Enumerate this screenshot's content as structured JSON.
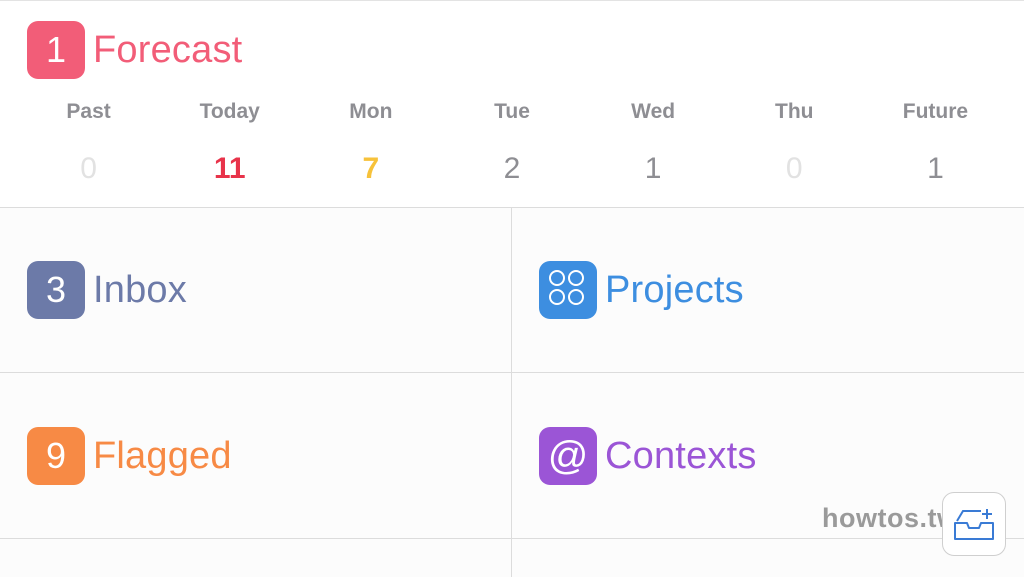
{
  "forecast": {
    "badge": "1",
    "title": "Forecast",
    "color": "#f25d78",
    "days": [
      {
        "label": "Past",
        "count": "0",
        "color": "#e2e2e2"
      },
      {
        "label": "Today",
        "count": "11",
        "color": "#e8334a"
      },
      {
        "label": "Mon",
        "count": "7",
        "color": "#f7c23a"
      },
      {
        "label": "Tue",
        "count": "2",
        "color": "#8e8e93"
      },
      {
        "label": "Wed",
        "count": "1",
        "color": "#8e8e93"
      },
      {
        "label": "Thu",
        "count": "0",
        "color": "#e2e2e2"
      },
      {
        "label": "Future",
        "count": "1",
        "color": "#8e8e93"
      }
    ]
  },
  "inbox": {
    "badge": "3",
    "title": "Inbox",
    "color": "#6c7aa8"
  },
  "projects": {
    "icon": "projects-dots-icon",
    "title": "Projects",
    "color": "#3d8ee0"
  },
  "flagged": {
    "badge": "9",
    "title": "Flagged",
    "color": "#f78a45"
  },
  "contexts": {
    "icon": "at-sign-icon",
    "symbol": "@",
    "title": "Contexts",
    "color": "#9b55d6"
  },
  "watermark": {
    "text": "howtos.tw"
  },
  "quick_entry": {
    "icon": "inbox-tray-add-icon"
  }
}
